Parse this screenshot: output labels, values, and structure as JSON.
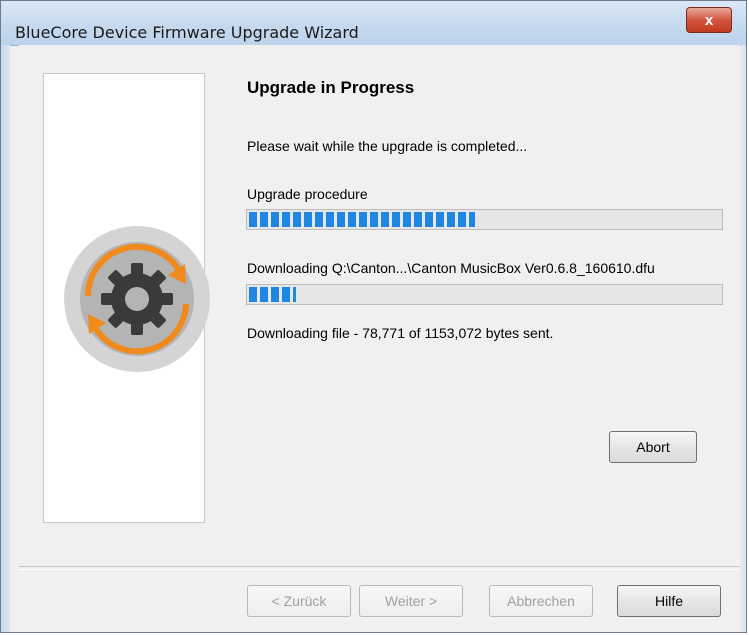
{
  "window": {
    "title": "BlueCore Device Firmware Upgrade Wizard",
    "close_symbol": "x"
  },
  "page": {
    "heading": "Upgrade in Progress",
    "wait_text": "Please wait while the upgrade is completed...",
    "procedure_label": "Upgrade procedure",
    "procedure_progress_fraction": 0.48,
    "download_label": "Downloading Q:\\Canton...\\Canton MusicBox Ver0.6.8_160610.dfu",
    "download_progress_fraction": 0.1,
    "status_text": "Downloading file - 78,771 of 1153,072 bytes sent."
  },
  "buttons": {
    "abort": "Abort",
    "back": "< Zurück",
    "next": "Weiter >",
    "cancel": "Abbrechen",
    "help": "Hilfe"
  },
  "icons": {
    "logo": "gear-refresh-icon",
    "close": "close-icon"
  },
  "colors": {
    "progress": "#1f87e3",
    "logo_arrows": "#f08a1c",
    "logo_gear": "#3a3a3a"
  }
}
